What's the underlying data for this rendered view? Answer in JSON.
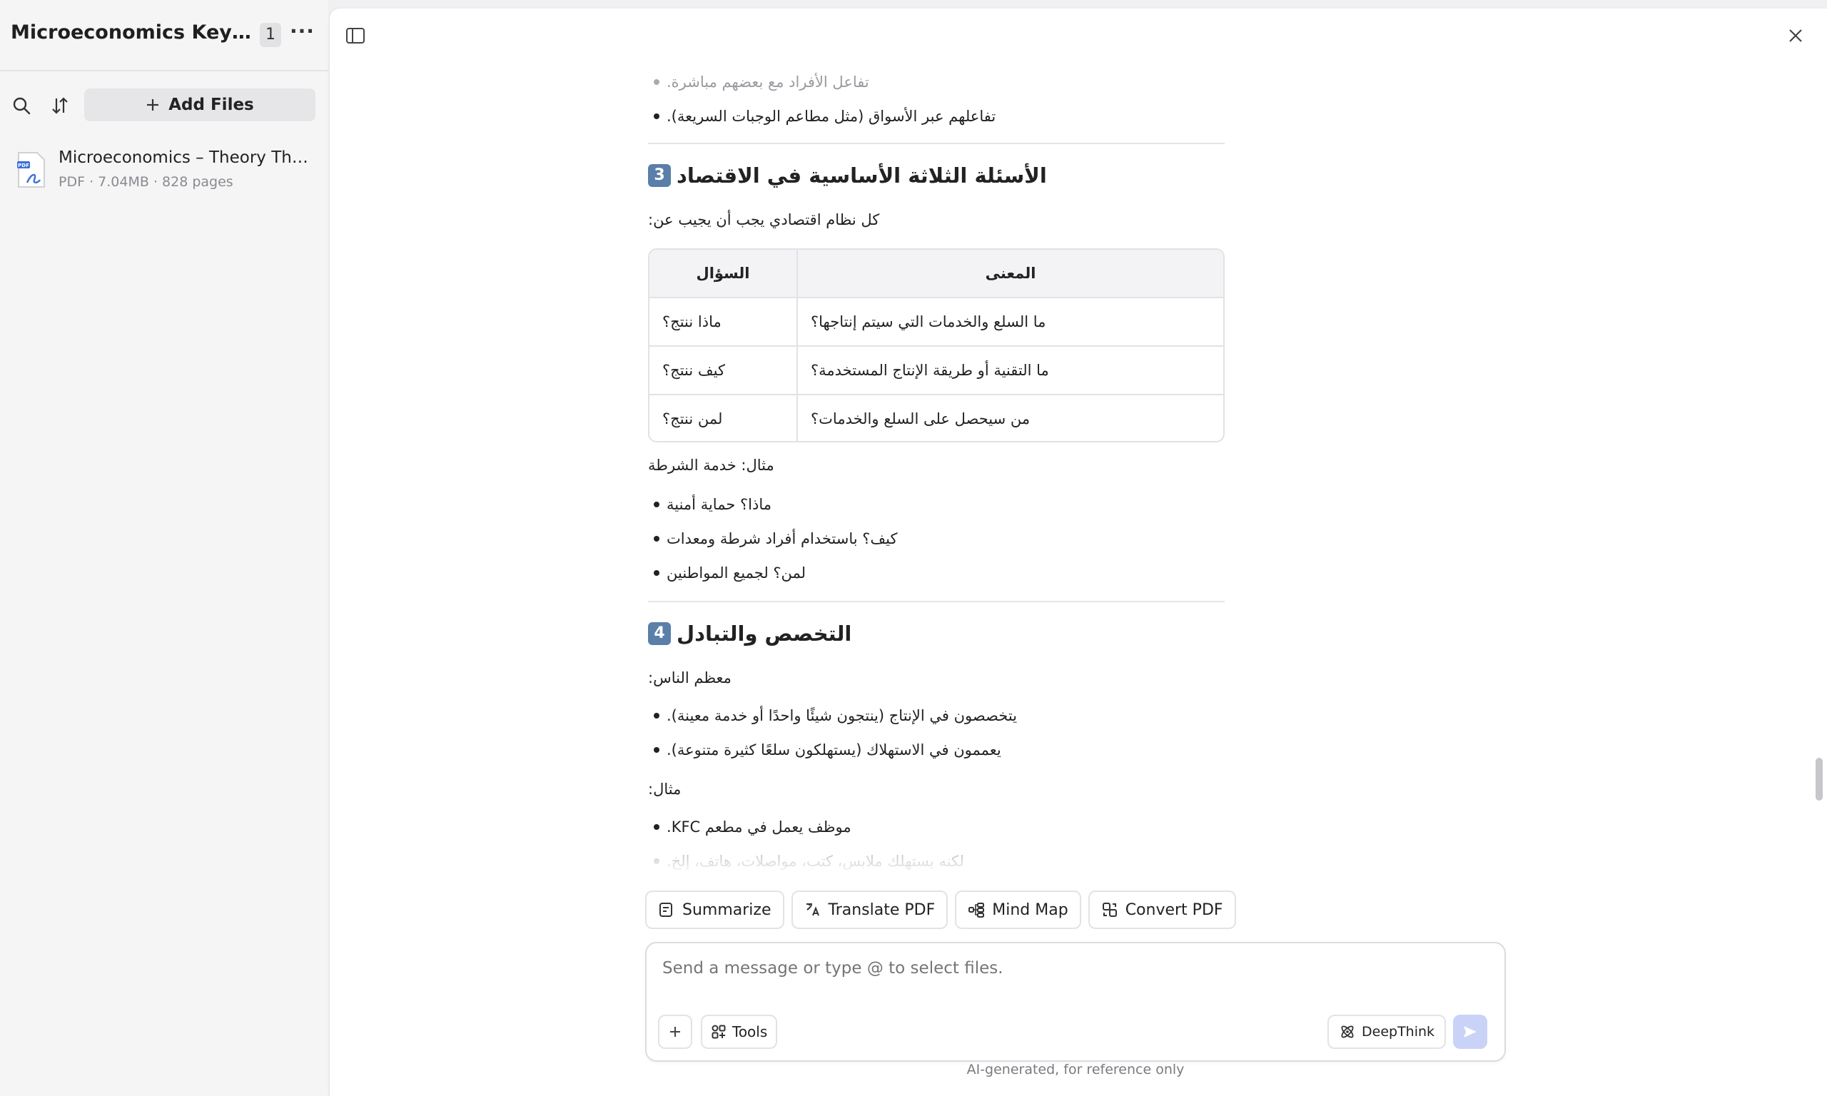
{
  "sidebar": {
    "title": "Microeconomics Key Con...",
    "count": "1",
    "add_files_label": "Add Files",
    "file": {
      "name": "Microeconomics – Theory Thr...",
      "type": "PDF",
      "size": "7.04MB",
      "pages": "828 pages"
    }
  },
  "content": {
    "bullets_top": [
      "تفاعل الأفراد مع بعضهم مباشرة.",
      "تفاعلهم عبر الأسواق (مثل مطاعم الوجبات السريعة)."
    ],
    "section3": {
      "badge": "3",
      "title": "الأسئلة الثلاثة الأساسية في الاقتصاد",
      "intro": "كل نظام اقتصادي يجب أن يجيب عن:",
      "table": {
        "headers": [
          "السؤال",
          "المعنى"
        ],
        "rows": [
          [
            "ماذا ننتج؟",
            "ما السلع والخدمات التي سيتم إنتاجها؟"
          ],
          [
            "كيف ننتج؟",
            "ما التقنية أو طريقة الإنتاج المستخدمة؟"
          ],
          [
            "لمن ننتج؟",
            "من سيحصل على السلع والخدمات؟"
          ]
        ]
      },
      "example_label": "مثال: خدمة الشرطة",
      "example_bullets": [
        "ماذا؟ حماية أمنية",
        "كيف؟ باستخدام أفراد شرطة ومعدات",
        "لمن؟ لجميع المواطنين"
      ]
    },
    "section4": {
      "badge": "4",
      "title": "التخصص والتبادل",
      "intro": "معظم الناس:",
      "bullets": [
        "يتخصصون في الإنتاج (ينتجون شيئًا واحدًا أو خدمة معينة).",
        "يعممون في الاستهلاك (يستهلكون سلعًا كثيرة متنوعة)."
      ],
      "example_label": "مثال:",
      "example_bullets": [
        "موظف يعمل في مطعم KFC.",
        "لكنه يستهلك ملابس، كتب، مواصلات، هاتف، إلخ."
      ]
    }
  },
  "actions": [
    "Summarize",
    "Translate PDF",
    "Mind Map",
    "Convert PDF"
  ],
  "composer": {
    "placeholder": "Send a message or type @ to select files.",
    "tools_label": "Tools",
    "deepthink_label": "DeepThink"
  },
  "disclaimer": "AI-generated, for reference only",
  "colors": {
    "accent_badge": "#5a7fa8",
    "send_button": "#c9d3f7"
  }
}
